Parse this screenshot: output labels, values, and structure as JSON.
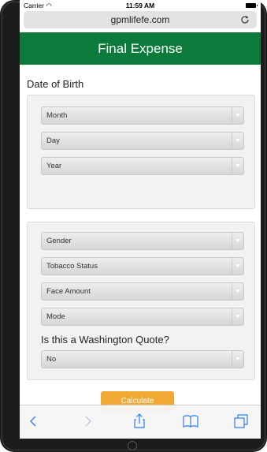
{
  "status": {
    "carrier": "Carrier",
    "time": "11:59 AM"
  },
  "browser": {
    "url": "gpmlifefe.com"
  },
  "header": {
    "title": "Final Expense"
  },
  "dob": {
    "label": "Date of Birth",
    "month": "Month",
    "day": "Day",
    "year": "Year"
  },
  "quote": {
    "gender": "Gender",
    "tobacco": "Tobacco Status",
    "face_amount": "Face Amount",
    "mode": "Mode",
    "washington_label": "Is this a Washington Quote?",
    "washington_value": "No"
  },
  "actions": {
    "calculate": "Calculate"
  },
  "colors": {
    "header": "#0b7a3a",
    "calculate": "#f0a935",
    "toolbar_icon": "#2f7cf6"
  }
}
